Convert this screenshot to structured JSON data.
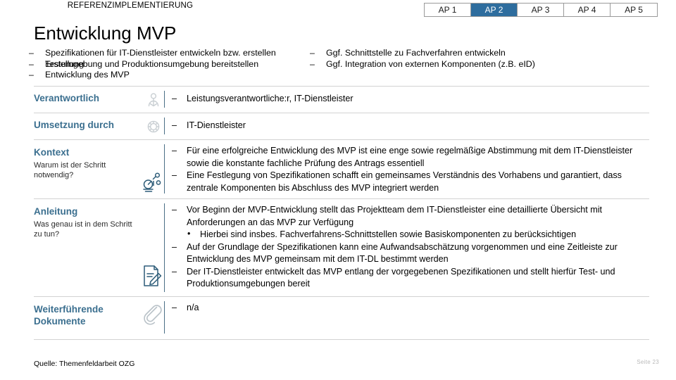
{
  "header": {
    "kicker": "REFERENZIMPLEMENTIERUNG",
    "title": "Entwicklung MVP",
    "accent_color": "#3b6f8f",
    "tab_active_bg": "#2e6d9e",
    "tabs": [
      {
        "label": "AP 1",
        "active": false
      },
      {
        "label": "AP 2",
        "active": true
      },
      {
        "label": "AP 3",
        "active": false
      },
      {
        "label": "AP 4",
        "active": false
      },
      {
        "label": "AP 5",
        "active": false
      }
    ]
  },
  "intro": {
    "left": [
      "Spezifikationen für IT-Dienstleister entwickeln bzw. erstellen",
      "Testumgebung und Produktionsumgebung bereitstellen",
      "Entwicklung des MVP"
    ],
    "left_overlap_ghost": "Erstellung",
    "right": [
      "Ggf. Schnittstelle zu Fachverfahren entwickeln",
      "Ggf. Integration von externen Komponenten (z.B. eID)"
    ]
  },
  "rows": [
    {
      "label": "Verantwortlich",
      "sub": "",
      "icon": "person-icon",
      "bullets": [
        {
          "level": 1,
          "text": "Leistungsverantwortliche:r, IT-Dienstleister"
        }
      ]
    },
    {
      "label": "Umsetzung durch",
      "sub": "",
      "icon": "gear-icon",
      "bullets": [
        {
          "level": 1,
          "text": "IT-Dienstleister"
        }
      ]
    },
    {
      "label": "Kontext",
      "sub": "Warum ist der Schritt notwendig?",
      "icon": "microscope-icon",
      "bullets": [
        {
          "level": 1,
          "text": "Für eine erfolgreiche Entwicklung des MVP ist eine enge sowie regelmäßige Abstimmung mit dem IT-Dienstleister sowie die konstante fachliche Prüfung des Antrags essentiell"
        },
        {
          "level": 1,
          "text": "Eine Festlegung von Spezifikationen schafft ein gemeinsames Verständnis des Vorhabens und garantiert, dass zentrale Komponenten bis Abschluss des MVP integriert werden"
        }
      ]
    },
    {
      "label": "Anleitung",
      "sub": "Was genau ist in dem Schritt zu tun?",
      "icon": "document-pencil-icon",
      "bullets": [
        {
          "level": 1,
          "text": "Vor Beginn der MVP-Entwicklung stellt das Projektteam dem IT-Dienstleister eine detaillierte Übersicht mit Anforderungen an das MVP zur Verfügung"
        },
        {
          "level": 2,
          "text": "Hierbei sind insbes. Fachverfahrens-Schnittstellen sowie Basiskomponenten zu berücksichtigen"
        },
        {
          "level": 1,
          "text": "Auf der Grundlage der Spezifikationen kann eine Aufwandsabschätzung vorgenommen und eine Zeitleiste zur Entwicklung des MVP gemeinsam mit dem IT-DL bestimmt werden"
        },
        {
          "level": 1,
          "text": "Der IT-Dienstleister entwickelt das MVP entlang der vorgegebenen Spezifikationen und stellt hierfür Test- und Produktionsumgebungen bereit"
        }
      ]
    },
    {
      "label": "Weiterführende Dokumente",
      "sub": "",
      "icon": "paperclip-icon",
      "bullets": [
        {
          "level": 1,
          "text": "n/a"
        }
      ]
    }
  ],
  "footer": {
    "source": "Quelle: Themenfeldarbeit OZG",
    "page": "Seite 23"
  }
}
